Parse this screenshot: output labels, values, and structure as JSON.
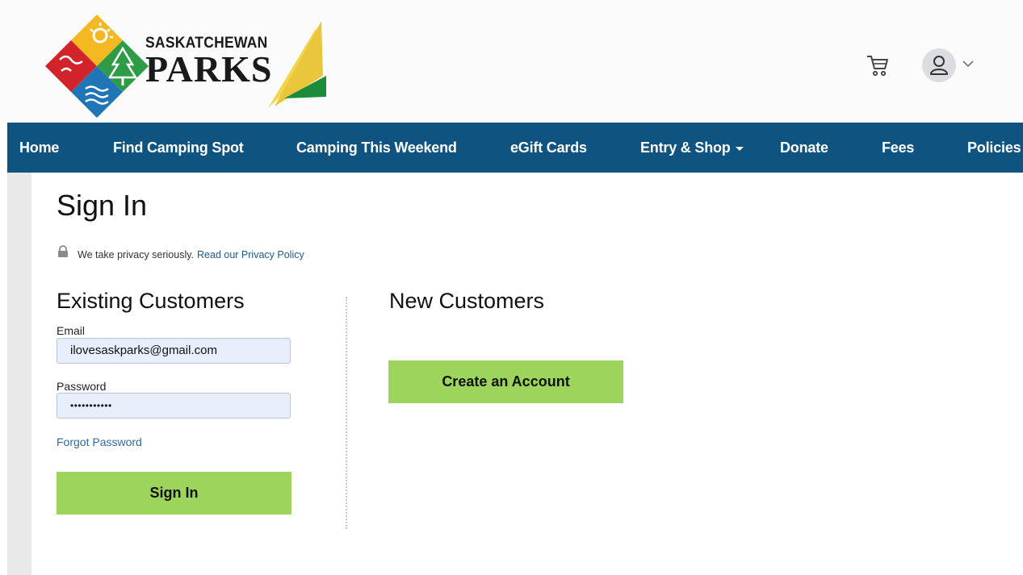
{
  "brand": {
    "line1": "SASKATCHEWAN",
    "line2": "PARKS",
    "colors": {
      "red": "#d2232a",
      "yellow": "#f4b823",
      "green": "#2e9b47",
      "blue": "#1f75b5",
      "green_flag": "#1a8c3a"
    }
  },
  "header": {
    "cart_icon": "cart-icon",
    "account_icon": "user-icon"
  },
  "nav": {
    "background": "#0f5480",
    "items": [
      {
        "label": "Home"
      },
      {
        "label": "Find Camping Spot"
      },
      {
        "label": "Camping This Weekend"
      },
      {
        "label": "eGift Cards"
      },
      {
        "label": "Entry & Shop"
      },
      {
        "label": "Donate"
      },
      {
        "label": "Fees"
      },
      {
        "label": "Policies"
      }
    ]
  },
  "page": {
    "title": "Sign In",
    "privacy_text": "We take privacy seriously.",
    "privacy_link": "Read our Privacy Policy"
  },
  "existing": {
    "title": "Existing Customers",
    "email_label": "Email",
    "email_value": "ilovesaskparks@gmail.com",
    "password_label": "Password",
    "password_value": "•••••••••••",
    "forgot_label": "Forgot Password",
    "signin_label": "Sign In"
  },
  "new_customers": {
    "title": "New Customers",
    "create_label": "Create an Account"
  },
  "accent_green": "#9dd45c"
}
